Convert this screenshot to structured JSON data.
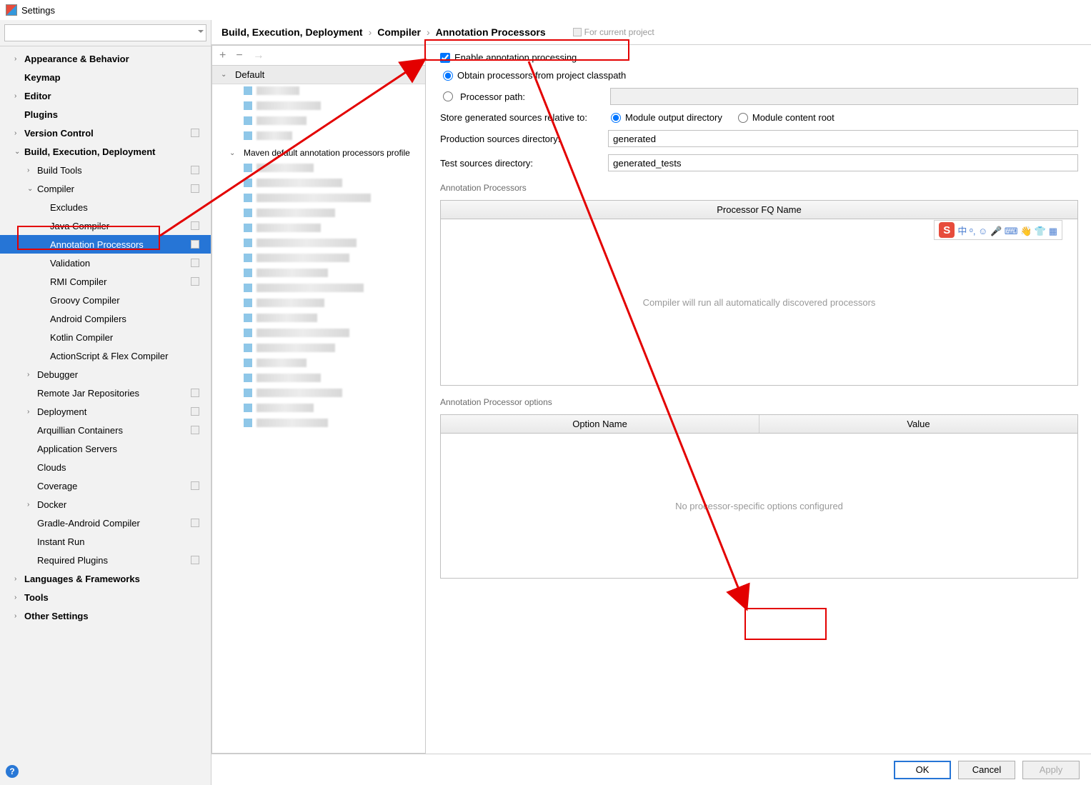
{
  "window": {
    "title": "Settings"
  },
  "search": {
    "placeholder": ""
  },
  "sidebar": {
    "items": [
      {
        "label": "Appearance & Behavior",
        "bold": true,
        "chev": "›",
        "lvl": 1
      },
      {
        "label": "Keymap",
        "bold": true,
        "lvl": 1,
        "nochev": true
      },
      {
        "label": "Editor",
        "bold": true,
        "chev": "›",
        "lvl": 1
      },
      {
        "label": "Plugins",
        "bold": true,
        "lvl": 1,
        "nochev": true
      },
      {
        "label": "Version Control",
        "bold": true,
        "chev": "›",
        "lvl": 1,
        "mod": true
      },
      {
        "label": "Build, Execution, Deployment",
        "bold": true,
        "chev": "⌄",
        "lvl": 1
      },
      {
        "label": "Build Tools",
        "chev": "›",
        "lvl": 2,
        "mod": true
      },
      {
        "label": "Compiler",
        "chev": "⌄",
        "lvl": 2,
        "mod": true
      },
      {
        "label": "Excludes",
        "lvl": 3
      },
      {
        "label": "Java Compiler",
        "lvl": 3,
        "mod": true
      },
      {
        "label": "Annotation Processors",
        "lvl": 3,
        "selected": true,
        "mod": true
      },
      {
        "label": "Validation",
        "lvl": 3,
        "mod": true
      },
      {
        "label": "RMI Compiler",
        "lvl": 3,
        "mod": true
      },
      {
        "label": "Groovy Compiler",
        "lvl": 3
      },
      {
        "label": "Android Compilers",
        "lvl": 3
      },
      {
        "label": "Kotlin Compiler",
        "lvl": 3
      },
      {
        "label": "ActionScript & Flex Compiler",
        "lvl": 3
      },
      {
        "label": "Debugger",
        "chev": "›",
        "lvl": 2
      },
      {
        "label": "Remote Jar Repositories",
        "lvl": 2,
        "mod": true
      },
      {
        "label": "Deployment",
        "chev": "›",
        "lvl": 2,
        "mod": true
      },
      {
        "label": "Arquillian Containers",
        "lvl": 2,
        "mod": true
      },
      {
        "label": "Application Servers",
        "lvl": 2
      },
      {
        "label": "Clouds",
        "lvl": 2
      },
      {
        "label": "Coverage",
        "lvl": 2,
        "mod": true
      },
      {
        "label": "Docker",
        "chev": "›",
        "lvl": 2
      },
      {
        "label": "Gradle-Android Compiler",
        "lvl": 2,
        "mod": true
      },
      {
        "label": "Instant Run",
        "lvl": 2
      },
      {
        "label": "Required Plugins",
        "lvl": 2,
        "mod": true
      },
      {
        "label": "Languages & Frameworks",
        "bold": true,
        "chev": "›",
        "lvl": 1
      },
      {
        "label": "Tools",
        "bold": true,
        "chev": "›",
        "lvl": 1
      },
      {
        "label": "Other Settings",
        "bold": true,
        "chev": "›",
        "lvl": 1
      }
    ]
  },
  "breadcrumb": {
    "parts": [
      "Build, Execution, Deployment",
      "Compiler",
      "Annotation Processors"
    ],
    "for_project": "For current project"
  },
  "profiles": {
    "default": "Default",
    "maven": "Maven default annotation processors profile"
  },
  "panel": {
    "enable": "Enable annotation processing",
    "obtain": "Obtain processors from project classpath",
    "procpath_label": "Processor path:",
    "store_label": "Store generated sources relative to:",
    "store_opt1": "Module output directory",
    "store_opt2": "Module content root",
    "prod_label": "Production sources directory:",
    "prod_value": "generated",
    "test_label": "Test sources directory:",
    "test_value": "generated_tests",
    "section1": "Annotation Processors",
    "table1_header": "Processor FQ Name",
    "table1_placeholder": "Compiler will run all automatically discovered processors",
    "section2": "Annotation Processor options",
    "table2_h1": "Option Name",
    "table2_h2": "Value",
    "table2_placeholder": "No processor-specific options configured"
  },
  "ime": {
    "s": "S",
    "chars": "中 ᵒ, ☺ 🎤 ⌨ 👋 👕 ▦"
  },
  "footer": {
    "ok": "OK",
    "cancel": "Cancel",
    "apply": "Apply"
  }
}
